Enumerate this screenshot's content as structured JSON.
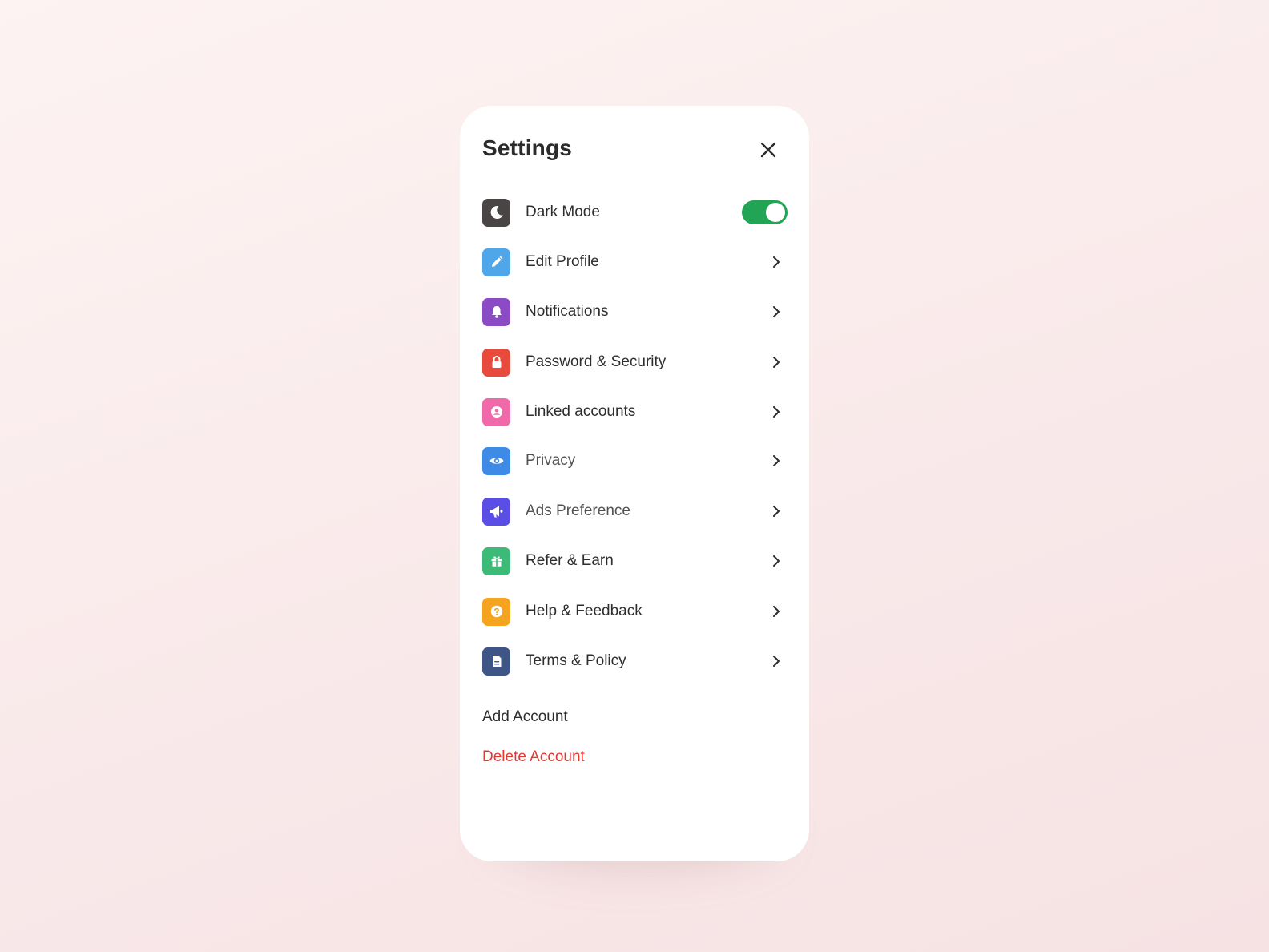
{
  "settings": {
    "title": "Settings",
    "items": [
      {
        "label": "Dark Mode",
        "icon": "moon-icon",
        "color": "#4a4545",
        "control": "toggle",
        "toggle_on": true
      },
      {
        "label": "Edit Profile",
        "icon": "pencil-icon",
        "color": "#4fa7ea",
        "control": "chevron"
      },
      {
        "label": "Notifications",
        "icon": "bell-icon",
        "color": "#8b4bc4",
        "control": "chevron"
      },
      {
        "label": "Password & Security",
        "icon": "lock-icon",
        "color": "#e84a3c",
        "control": "chevron"
      },
      {
        "label": "Linked accounts",
        "icon": "user-circle-icon",
        "color": "#f06aaa",
        "control": "chevron"
      },
      {
        "label": "Privacy",
        "icon": "eye-icon",
        "color": "#3d8be6",
        "control": "chevron"
      },
      {
        "label": "Ads Preference",
        "icon": "megaphone-icon",
        "color": "#5a4ee6",
        "control": "chevron"
      },
      {
        "label": "Refer & Earn",
        "icon": "gift-icon",
        "color": "#3dba78",
        "control": "chevron"
      },
      {
        "label": "Help & Feedback",
        "icon": "question-circle-icon",
        "color": "#f5a41f",
        "control": "chevron"
      },
      {
        "label": "Terms & Policy",
        "icon": "document-icon",
        "color": "#3e5586",
        "control": "chevron"
      }
    ],
    "add_account": "Add Account",
    "delete_account": "Delete Account",
    "colors": {
      "toggle_on": "#21a453",
      "danger": "#e5392f",
      "text": "#2e2e2e"
    }
  }
}
